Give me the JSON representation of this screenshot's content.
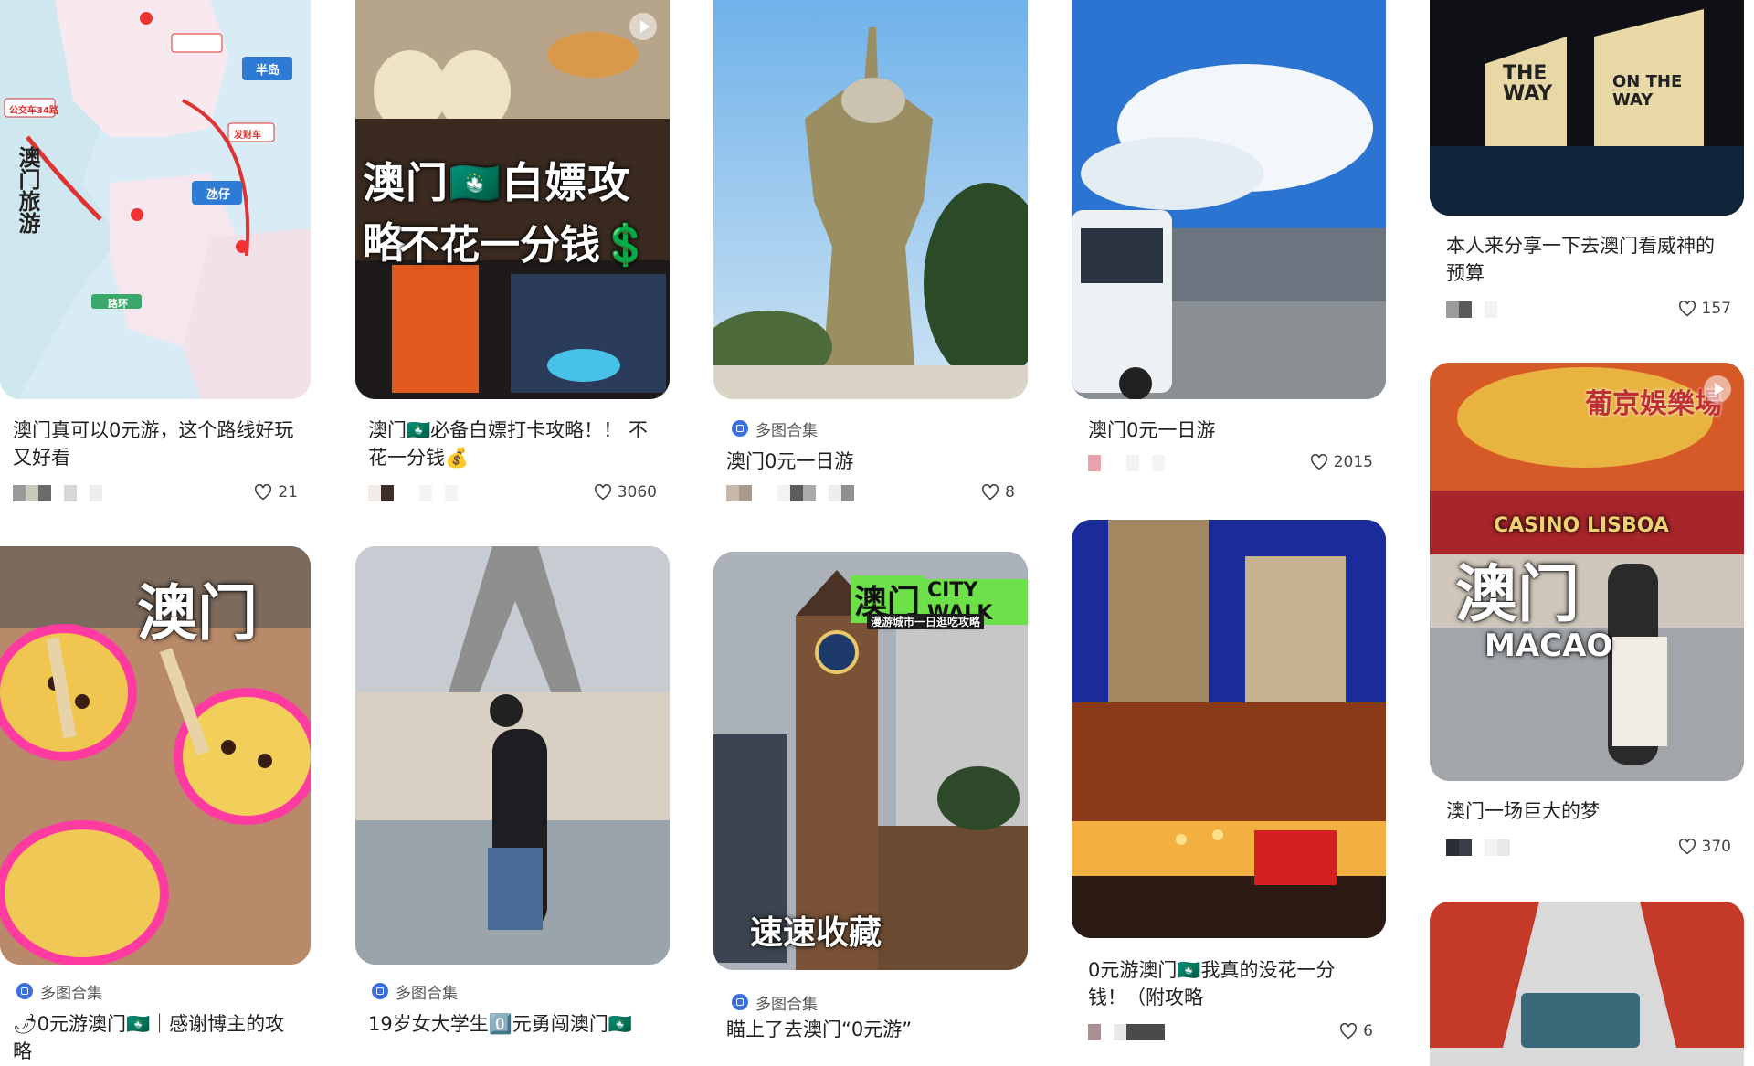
{
  "cards": [
    {
      "title": "澳门真可以0元游，这个路线好玩又好看",
      "likes": "21",
      "image_text": "澳门旅游",
      "map_labels": [
        "半岛",
        "氹仔",
        "路环",
        "公交车34路",
        "发财车"
      ]
    },
    {
      "title": "澳门🇲🇴必备白嫖打卡攻略！！ 不花一分钱💰",
      "likes": "3060",
      "image_text_1": "澳门🇲🇴白嫖攻略",
      "image_text_2": "不花一分钱💲"
    },
    {
      "tag": "多图合集",
      "title": "澳门0元一日游",
      "likes": "8"
    },
    {
      "title": "澳门0元一日游",
      "likes": "2015"
    },
    {
      "title": "本人来分享一下去澳门看威神的预算",
      "likes": "157",
      "image_text_1": "THE WAY",
      "image_text_2": "ON THE WAY"
    },
    {
      "title": "澳门一场巨大的梦",
      "likes": "370",
      "image_text_1": "澳门",
      "image_text_2": "MACAO",
      "image_text_3": "CASINO LISBOA",
      "image_text_4": "葡京娛樂場"
    },
    {
      "tag": "多图合集",
      "title": "🌶0元游澳门🇲🇴｜感谢博主的攻略",
      "image_text": "澳门"
    },
    {
      "tag": "多图合集",
      "title": "19岁女大学生0️⃣元勇闯澳门🇲🇴"
    },
    {
      "tag": "多图合集",
      "title": "瞄上了去澳门“0元游”",
      "image_text_1": "澳门",
      "image_text_2": "CITY WALK",
      "image_text_3": "漫游城市一日逛吃攻略",
      "image_text_4": "速速收藏"
    },
    {
      "title": "0元游澳门🇲🇴我真的没花一分钱！（附攻略",
      "likes": "6"
    }
  ],
  "colors": {
    "tag_icon": "#3b6fe0",
    "heart": "#444444"
  }
}
